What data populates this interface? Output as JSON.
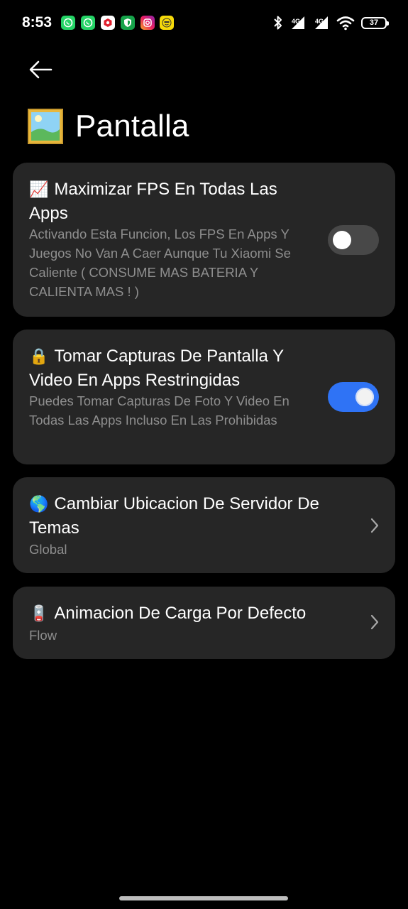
{
  "status_bar": {
    "time": "8:53",
    "battery": "37",
    "notification_icons": [
      "whatsapp-icon",
      "whatsapp-icon",
      "app-red-icon",
      "shield-green-icon",
      "instagram-icon",
      "emoji-yellow-icon"
    ],
    "right_icons": [
      "bluetooth-icon",
      "signal-icon",
      "signal-icon",
      "wifi-icon",
      "battery-icon"
    ]
  },
  "header": {
    "back_icon": "back-arrow-icon",
    "title_icon": "framed-picture-icon",
    "title": "Pantalla"
  },
  "settings": [
    {
      "emoji": "📈",
      "title": "Maximizar FPS En Todas Las Apps",
      "description": "Activando Esta Funcion, Los FPS En Apps Y Juegos No Van A Caer Aunque Tu Xiaomi Se Caliente ( CONSUME MAS BATERIA Y CALIENTA MAS ! )",
      "control": "toggle",
      "enabled": false
    },
    {
      "emoji": "🔒",
      "title": "Tomar Capturas De Pantalla Y Video En Apps Restringidas",
      "description": "Puedes Tomar Capturas De Foto Y Video En Todas Las Apps Incluso En Las Prohibidas",
      "control": "toggle",
      "enabled": true
    },
    {
      "emoji": "🌎",
      "title": "Cambiar Ubicacion De Servidor De Temas",
      "value": "Global",
      "control": "chevron"
    },
    {
      "emoji": "🪫",
      "title": "Animacion De Carga Por Defecto",
      "value": "Flow",
      "control": "chevron"
    }
  ],
  "colors": {
    "background": "#000000",
    "card": "#262626",
    "accent": "#2f73f5",
    "secondary_text": "#8e8e8e"
  }
}
